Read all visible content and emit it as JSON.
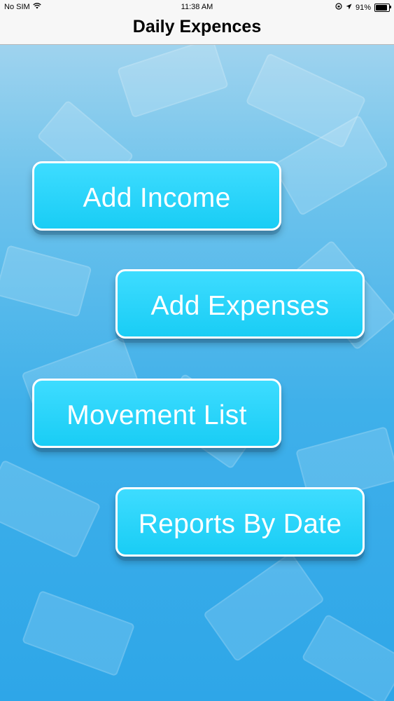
{
  "status_bar": {
    "carrier": "No SIM",
    "wifi_icon": "wifi-icon",
    "time": "11:38 AM",
    "rotation_lock_icon": "rotation-lock-icon",
    "location_icon": "location-arrow-icon",
    "battery_percent_text": "91%",
    "battery_level": 0.91
  },
  "nav": {
    "title": "Daily Expences"
  },
  "menu": {
    "add_income": "Add Income",
    "add_expenses": "Add Expenses",
    "movement_list": "Movement List",
    "reports_by_date": "Reports By Date"
  },
  "colors": {
    "button_fill": "#19cdf5",
    "button_border": "#ffffff",
    "background_top": "#9fd3ee",
    "background_bottom": "#2ea6e8"
  }
}
